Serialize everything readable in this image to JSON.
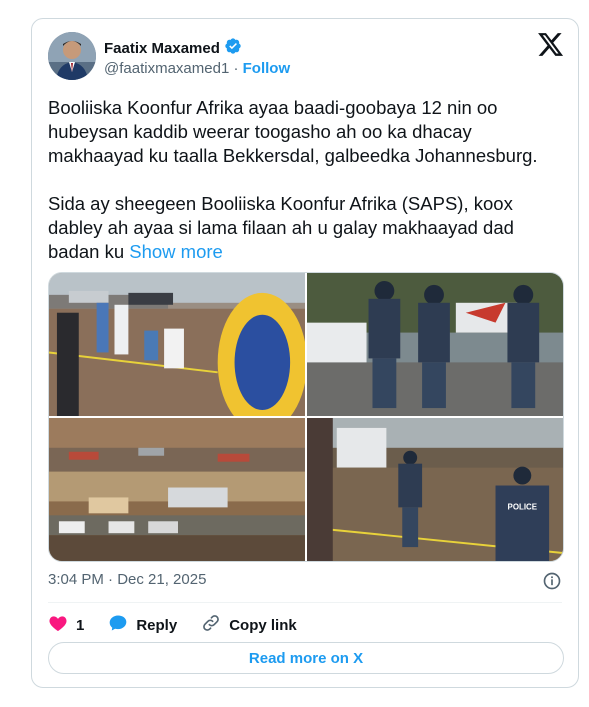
{
  "author": {
    "name": "Faatix Maxamed",
    "handle": "@faatixmaxamed1",
    "separator": "·",
    "follow_label": "Follow",
    "verified_color": "#1d9bf0"
  },
  "post": {
    "text": "Booliiska Koonfur Afrika ayaa baadi-goobaya 12 nin oo hubeysan kaddib weerar toogasho ah oo ka dhacay makhaayad ku taalla Bekkersdal, galbeedka Johannesburg.\n\nSida ay sheegeen Booliiska Koonfur Afrika (SAPS), koox dabley ah ayaa si lama filaan ah u galay makhaayad dad badan ku ",
    "show_more_label": "Show more",
    "timestamp": "3:04 PM · Dec 21, 2025",
    "photo_sign": "POLICE"
  },
  "actions": {
    "like_count": "1",
    "reply_label": "Reply",
    "copy_label": "Copy link",
    "like_color": "#f91880",
    "reply_color": "#1d9bf0"
  },
  "footer": {
    "read_more_label": "Read more on X"
  }
}
